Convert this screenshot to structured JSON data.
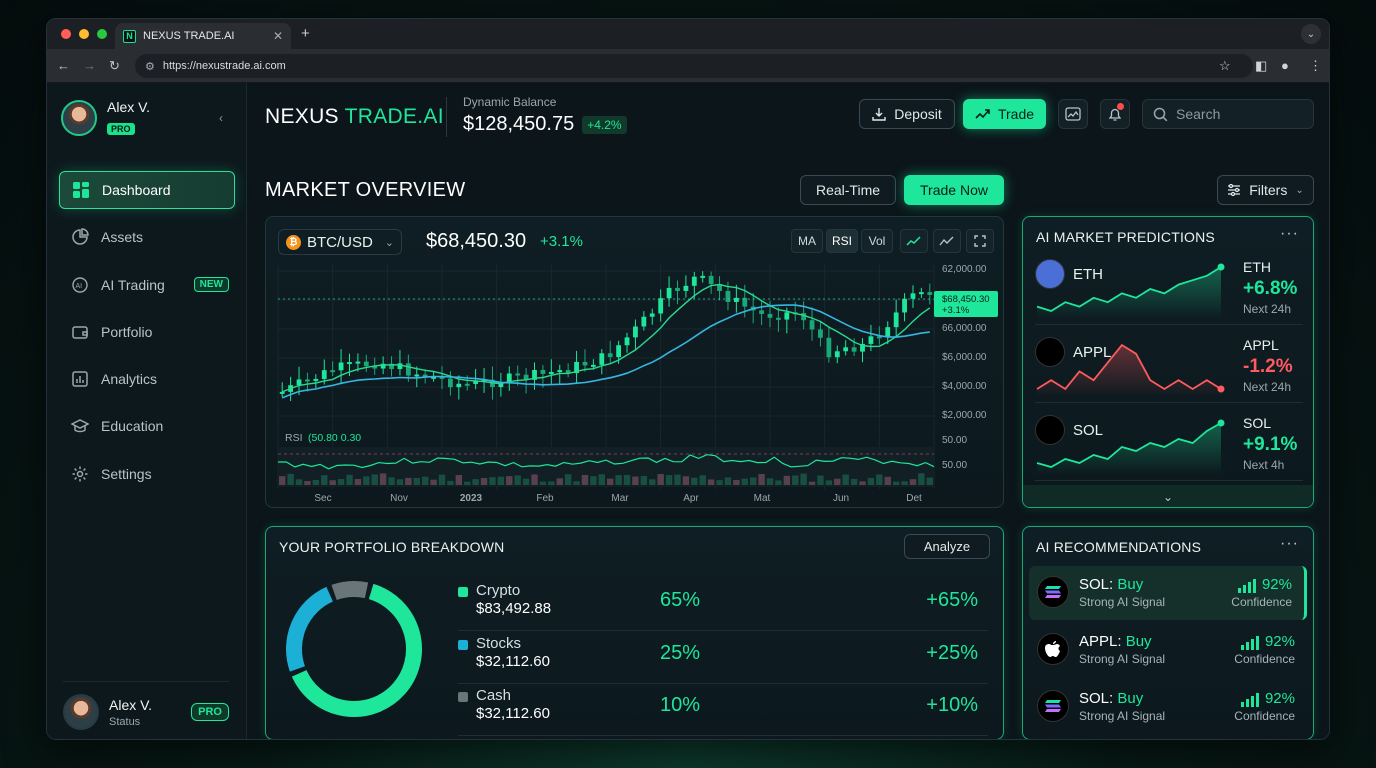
{
  "browser": {
    "tab_title": "NEXUS TRADE.AI",
    "favicon_letter": "N",
    "url": "https://nexustrade.ai.com"
  },
  "sidebar": {
    "user_name": "Alex V.",
    "user_badge": "PRO",
    "items": [
      {
        "label": "Dashboard",
        "icon": "grid-icon",
        "active": true
      },
      {
        "label": "Assets",
        "icon": "pie-icon"
      },
      {
        "label": "AI Trading",
        "icon": "ai-chip-icon",
        "badge": "NEW"
      },
      {
        "label": "Portfolio",
        "icon": "wallet-icon"
      },
      {
        "label": "Analytics",
        "icon": "bar-chart-icon"
      },
      {
        "label": "Education",
        "icon": "graduation-cap-icon"
      },
      {
        "label": "Settings",
        "icon": "gear-icon"
      }
    ],
    "bottom_user": {
      "name": "Alex V.",
      "status": "Status",
      "badge": "PRO"
    }
  },
  "header": {
    "brand_a": "NEXUS ",
    "brand_b": "TRADE.AI",
    "balance_label": "Dynamic Balance",
    "balance_value": "$128,450.75",
    "balance_change": "+4.2%",
    "deposit_label": "Deposit",
    "trade_label": "Trade",
    "search_placeholder": "Search"
  },
  "market": {
    "title": "MARKET OVERVIEW",
    "realtime_label": "Real-Time",
    "trade_now_label": "Trade Now",
    "filters_label": "Filters"
  },
  "chart_data": {
    "type": "line",
    "pair": "BTC/USD",
    "price": "$68,450.30",
    "change": "+3.1%",
    "tools": [
      "MA",
      "RSI",
      "Vol"
    ],
    "price_tag": "$68,450.30",
    "price_tag_change": "+3.1%",
    "y_tick_labels": [
      "62,000.00",
      "66,000.00",
      "$6,000.00",
      "$4,000.00",
      "$2,000.00",
      "50.00",
      "50.00"
    ],
    "x_tick_labels": [
      "Sec",
      "Nov",
      "2023",
      "Feb",
      "Mar",
      "Apr",
      "Mat",
      "Jun",
      "Det"
    ],
    "rsi_label": "RSI",
    "rsi_values": "(50.80  0.30"
  },
  "predictions": {
    "title": "AI MARKET PREDICTIONS",
    "items": [
      {
        "name": "ETH",
        "symbol": "ETH",
        "change": "+6.8%",
        "horizon": "Next 24h",
        "color": "#1ee69a",
        "series": [
          5,
          4,
          6,
          5,
          7,
          6,
          8,
          7,
          9,
          8,
          10,
          11,
          12,
          14
        ]
      },
      {
        "name": "APPL",
        "symbol": "APPL",
        "change": "-1.2%",
        "horizon": "Next 24h",
        "color": "#ff5a5f",
        "series": [
          4,
          5,
          4,
          6,
          5,
          7,
          9,
          8,
          5,
          4,
          5,
          4,
          5,
          4
        ]
      },
      {
        "name": "SOL",
        "symbol": "SOL",
        "change": "+9.1%",
        "horizon": "Next 4h",
        "color": "#1ee69a",
        "series": [
          4,
          3,
          5,
          4,
          6,
          5,
          8,
          7,
          9,
          8,
          10,
          9,
          12,
          14
        ]
      }
    ]
  },
  "portfolio": {
    "title": "YOUR PORTFOLIO BREAKDOWN",
    "analyze_label": "Analyze",
    "rows": [
      {
        "name": "Crypto",
        "value": "$83,492.88",
        "pct": "65%",
        "change": "+65%",
        "color": "#1ee69a",
        "share": 0.65
      },
      {
        "name": "Stocks",
        "value": "$32,112.60",
        "pct": "25%",
        "change": "+25%",
        "color": "#1cb0d6",
        "share": 0.25
      },
      {
        "name": "Cash",
        "value": "$32,112.60",
        "pct": "10%",
        "change": "+10%",
        "color": "#6a757a",
        "share": 0.1
      }
    ]
  },
  "recommendations": {
    "title": "AI RECOMMENDATIONS",
    "items": [
      {
        "asset": "SOL: ",
        "action": "Buy",
        "signal": "Strong AI Signal",
        "confidence": "92%",
        "conf_label": "Confidence",
        "icon": "solana-icon"
      },
      {
        "asset": "APPL: ",
        "action": "Buy",
        "signal": "Strong AI Signal",
        "confidence": "92%",
        "conf_label": "Confidence",
        "icon": "apple-icon"
      },
      {
        "asset": "SOL: ",
        "action": "Buy",
        "signal": "Strong AI Signal",
        "confidence": "92%",
        "conf_label": "Confidence",
        "icon": "solana-icon"
      }
    ]
  }
}
